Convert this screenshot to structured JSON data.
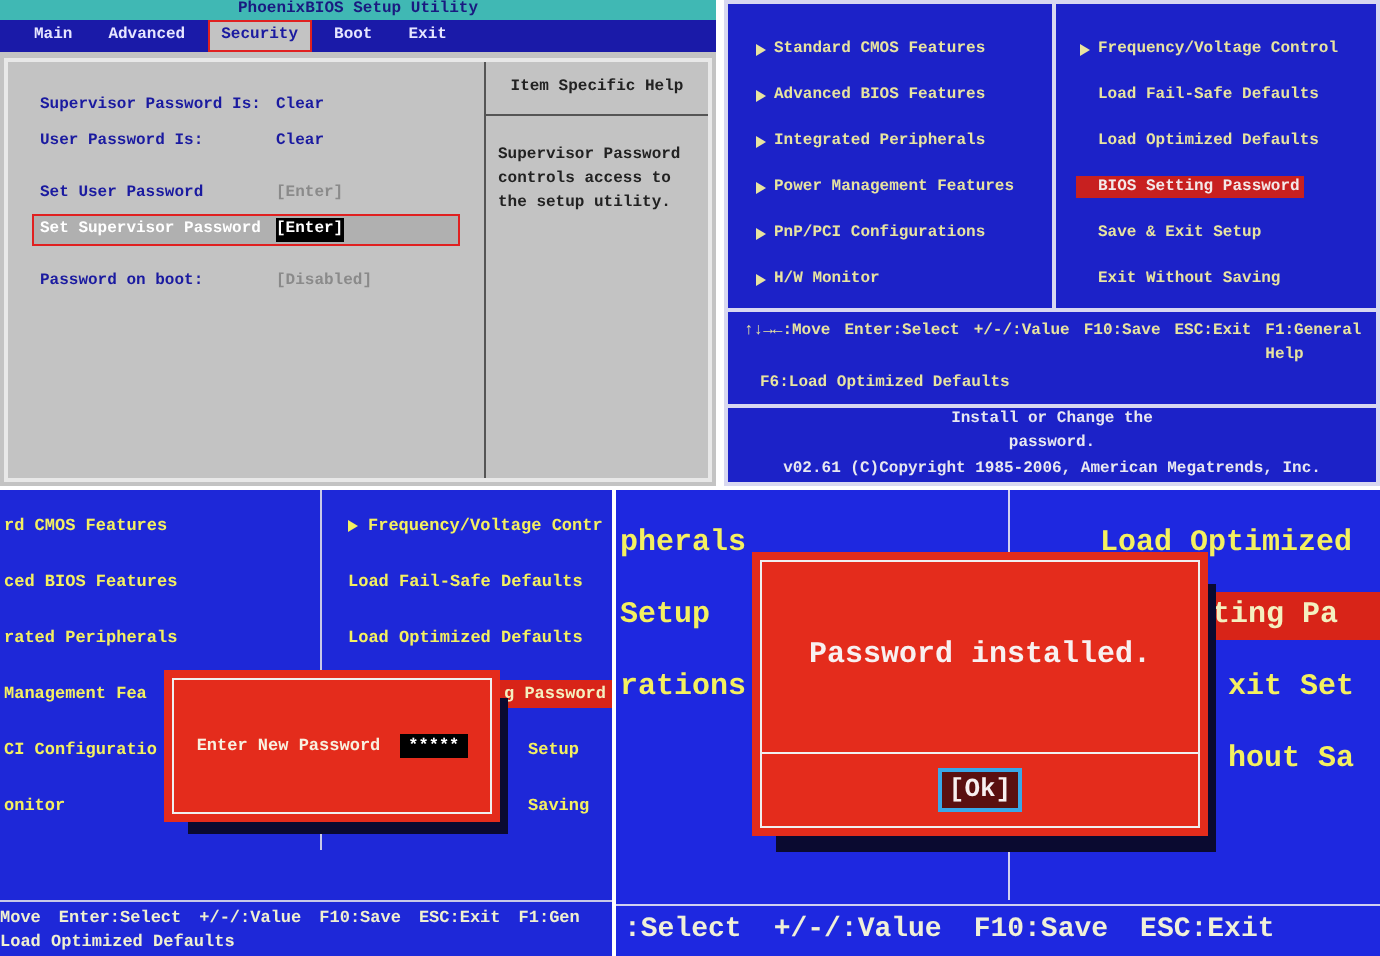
{
  "phoenix_setup": {
    "title": "PhoenixBIOS Setup Utility",
    "tabs": [
      {
        "label": "Main",
        "selected": false
      },
      {
        "label": "Advanced",
        "selected": false
      },
      {
        "label": "Security",
        "selected": true
      },
      {
        "label": "Boot",
        "selected": false
      },
      {
        "label": "Exit",
        "selected": false
      }
    ],
    "groups": [
      [
        {
          "label": "Supervisor Password Is:",
          "value": "Clear",
          "kind": "status",
          "selected": false
        },
        {
          "label": "User Password Is:",
          "value": "Clear",
          "kind": "status",
          "selected": false
        }
      ],
      [
        {
          "label": "Set User Password",
          "value": "[Enter]",
          "kind": "option",
          "selected": false
        },
        {
          "label": "Set Supervisor Password",
          "value": "[Enter]",
          "kind": "option",
          "selected": true
        }
      ],
      [
        {
          "label": "Password on boot:",
          "value": "[Disabled]",
          "kind": "option",
          "selected": false
        }
      ]
    ],
    "help_title": "Item Specific Help",
    "help_text": "Supervisor Password controls access to the setup utility."
  },
  "ami_setup": {
    "left_items": [
      {
        "label": "Standard CMOS Features",
        "submenu": true
      },
      {
        "label": "Advanced BIOS Features",
        "submenu": true
      },
      {
        "label": "Integrated Peripherals",
        "submenu": true
      },
      {
        "label": "Power Management Features",
        "submenu": true
      },
      {
        "label": "PnP/PCI Configurations",
        "submenu": true
      },
      {
        "label": "H/W Monitor",
        "submenu": true
      }
    ],
    "right_items": [
      {
        "label": "Frequency/Voltage Control",
        "submenu": true,
        "selected": false
      },
      {
        "label": "Load Fail-Safe Defaults",
        "submenu": false,
        "selected": false
      },
      {
        "label": "Load Optimized Defaults",
        "submenu": false,
        "selected": false
      },
      {
        "label": "BIOS Setting Password",
        "submenu": false,
        "selected": true
      },
      {
        "label": "Save & Exit Setup",
        "submenu": false,
        "selected": false
      },
      {
        "label": "Exit Without Saving",
        "submenu": false,
        "selected": false
      }
    ],
    "key_help": [
      [
        "↑↓→←:Move",
        "Enter:Select",
        "+/-/:Value",
        "F10:Save",
        "ESC:Exit",
        "F1:General Help"
      ],
      [
        "F6:Load Optimized Defaults"
      ]
    ],
    "item_help": "Install or Change the password.",
    "copyright": "v02.61 (C)Copyright 1985-2006, American Megatrends, Inc."
  },
  "password_prompt": {
    "left_items": [
      "rd CMOS Features",
      "ced BIOS Features",
      "rated Peripherals",
      "Management Fea",
      "CI Configuratio",
      "onitor"
    ],
    "right_items": [
      {
        "label": "Frequency/Voltage Contr",
        "submenu": true,
        "selected": false
      },
      {
        "label": "Load Fail-Safe Defaults",
        "submenu": false,
        "selected": false
      },
      {
        "label": "Load Optimized Defaults",
        "submenu": false,
        "selected": false
      },
      {
        "label": "g Password",
        "submenu": false,
        "selected": true
      },
      {
        "label": "Setup",
        "submenu": false,
        "selected": false
      },
      {
        "label": "Saving",
        "submenu": false,
        "selected": false
      }
    ],
    "dialog": {
      "label": "Enter New Password",
      "value": "*****"
    },
    "key_help": [
      "Move",
      "Enter:Select",
      "+/-/:Value",
      "F10:Save",
      "ESC:Exit",
      "F1:Gen"
    ],
    "key_help_2": "Load Optimized Defaults"
  },
  "password_confirm": {
    "left_items": [
      "pherals",
      "Setup",
      "rations"
    ],
    "right_items": [
      {
        "label": "Load Optimized",
        "selected": false
      },
      {
        "label": "ting Pa",
        "selected": true
      },
      {
        "label": "xit Set",
        "selected": false
      },
      {
        "label": "hout Sa",
        "selected": false
      }
    ],
    "dialog": {
      "message": "Password installed.",
      "button": "[Ok]"
    },
    "key_help": [
      ":Select",
      "+/-/:Value",
      "F10:Save",
      "ESC:Exit"
    ]
  }
}
